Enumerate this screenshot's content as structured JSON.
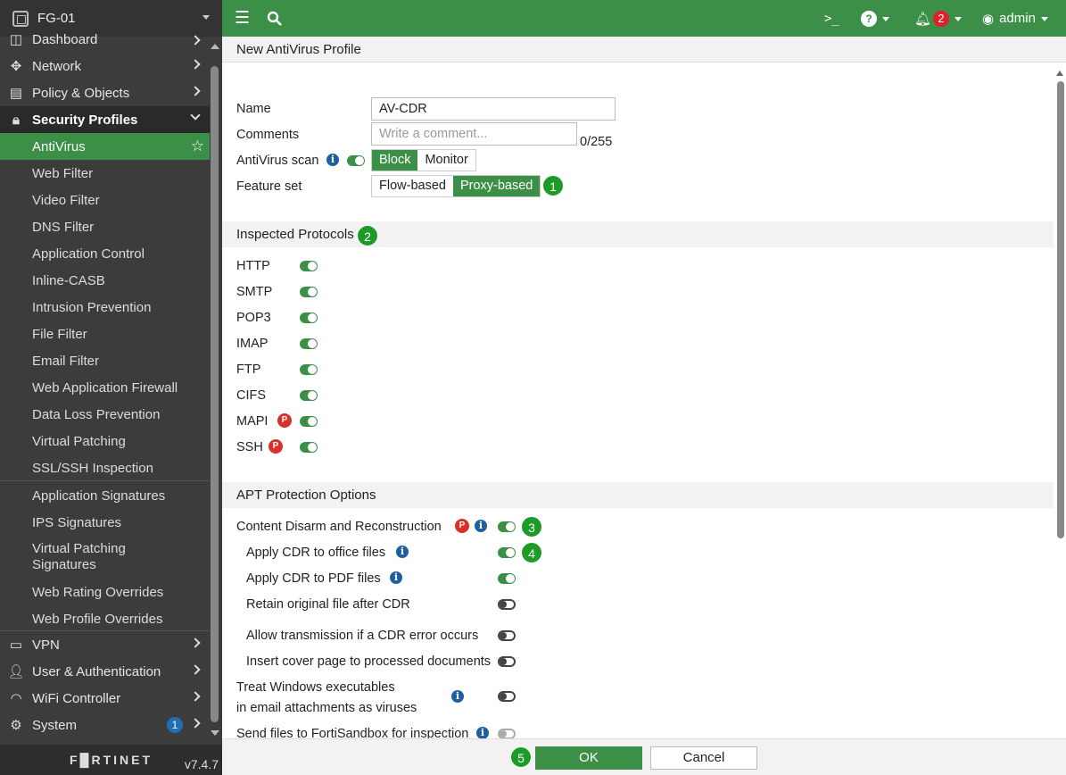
{
  "device": "FG-01",
  "version": "v7.4.7",
  "brand": "F█RTINET",
  "colors": {
    "accent": "#3c8f46",
    "sidebar": "#3c3c3c",
    "badge_red": "#e0202a",
    "badge_green": "#1e9a28"
  },
  "nav": {
    "dashboard": "Dashboard",
    "network": "Network",
    "policy": "Policy & Objects",
    "security": "Security Profiles",
    "vpn": "VPN",
    "user": "User & Authentication",
    "wifi": "WiFi Controller",
    "system": "System",
    "system_badge": "1"
  },
  "security_items": [
    "AntiVirus",
    "Web Filter",
    "Video Filter",
    "DNS Filter",
    "Application Control",
    "Inline-CASB",
    "Intrusion Prevention",
    "File Filter",
    "Email Filter",
    "Web Application Firewall",
    "Data Loss Prevention",
    "Virtual Patching",
    "SSL/SSH Inspection"
  ],
  "security_items2": [
    "Application Signatures",
    "IPS Signatures",
    "Virtual Patching Signatures",
    "Web Rating Overrides",
    "Web Profile Overrides"
  ],
  "topbar": {
    "user": "admin",
    "notifications": "2"
  },
  "page_title": "New AntiVirus Profile",
  "form": {
    "name_label": "Name",
    "name_value": "AV-CDR",
    "comments_label": "Comments",
    "comments_placeholder": "Write a comment...",
    "comments_count": "0/255",
    "scan_label": "AntiVirus scan",
    "scan_block": "Block",
    "scan_monitor": "Monitor",
    "feature_label": "Feature set",
    "flow": "Flow-based",
    "proxy": "Proxy-based"
  },
  "protocols_title": "Inspected Protocols",
  "protocols": [
    "HTTP",
    "SMTP",
    "POP3",
    "IMAP",
    "FTP",
    "CIFS",
    "MAPI",
    "SSH"
  ],
  "apt_title": "APT Protection Options",
  "apt": {
    "cdr": "Content Disarm and Reconstruction",
    "office": "Apply CDR to office files",
    "pdf": "Apply CDR to PDF files",
    "retain": "Retain original file after CDR",
    "allow": "Allow transmission if a CDR error occurs",
    "cover": "Insert cover page to processed documents",
    "treat1": "Treat Windows executables",
    "treat2": "in email attachments as viruses",
    "sandbox": "Send files to FortiSandbox for inspection"
  },
  "callouts": [
    "1",
    "2",
    "3",
    "4",
    "5"
  ],
  "buttons": {
    "ok": "OK",
    "cancel": "Cancel"
  }
}
